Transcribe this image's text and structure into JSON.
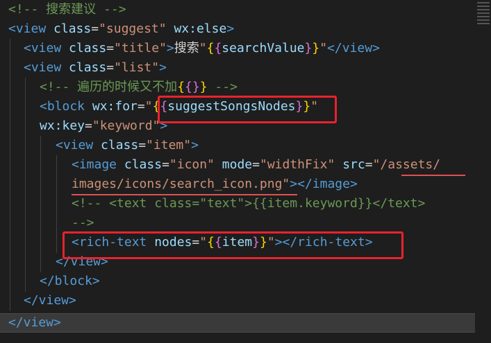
{
  "colors": {
    "background": "#1e1e1e",
    "comment": "#6a9955",
    "tag": "#569cd6",
    "attribute": "#9cdcfe",
    "string": "#ce9178",
    "text": "#d4d4d4",
    "bracket_gold": "#ffd700",
    "highlight_box": "#e8232f"
  },
  "code": [
    [
      [
        "cm",
        "<!-- 搜索建议 -->"
      ]
    ],
    [
      [
        "tag",
        "<view"
      ],
      [
        "txt",
        " "
      ],
      [
        "attr",
        "class"
      ],
      [
        "eq",
        "="
      ],
      [
        "str",
        "\"suggest\""
      ],
      [
        "txt",
        " "
      ],
      [
        "attr",
        "wx:else"
      ],
      [
        "tag",
        ">"
      ]
    ],
    [
      [
        "tag",
        "<view"
      ],
      [
        "txt",
        " "
      ],
      [
        "attr",
        "class"
      ],
      [
        "eq",
        "="
      ],
      [
        "str",
        "\"title\""
      ],
      [
        "tag",
        ">"
      ],
      [
        "txt",
        "搜索"
      ],
      [
        "str",
        "\""
      ],
      [
        "b1",
        "{"
      ],
      [
        "b2",
        "{"
      ],
      [
        "var",
        "searchValue"
      ],
      [
        "b2",
        "}"
      ],
      [
        "b1",
        "}"
      ],
      [
        "str",
        "\""
      ],
      [
        "tag",
        "</view>"
      ]
    ],
    [
      [
        "tag",
        "<view"
      ],
      [
        "txt",
        " "
      ],
      [
        "attr",
        "class"
      ],
      [
        "eq",
        "="
      ],
      [
        "str",
        "\"list\""
      ],
      [
        "tag",
        ">"
      ]
    ],
    [
      [
        "cm",
        "<!-- 遍历的时候又不加"
      ],
      [
        "b1",
        "{"
      ],
      [
        "b2",
        "{"
      ],
      [
        "b2",
        "}"
      ],
      [
        "b1",
        "}"
      ],
      [
        "cm",
        " -->"
      ]
    ],
    [
      [
        "tag",
        "<block"
      ],
      [
        "txt",
        " "
      ],
      [
        "attr",
        "wx:for"
      ],
      [
        "eq",
        "="
      ],
      [
        "str",
        "\""
      ],
      [
        "b1",
        "{"
      ],
      [
        "b2",
        "{"
      ],
      [
        "var",
        "suggestSongsNodes"
      ],
      [
        "b2",
        "}"
      ],
      [
        "b1",
        "}"
      ],
      [
        "str",
        "\""
      ]
    ],
    [
      [
        "attr",
        "wx:key"
      ],
      [
        "eq",
        "="
      ],
      [
        "str",
        "\"keyword\""
      ],
      [
        "tag",
        ">"
      ]
    ],
    [
      [
        "tag",
        "<view"
      ],
      [
        "txt",
        " "
      ],
      [
        "attr",
        "class"
      ],
      [
        "eq",
        "="
      ],
      [
        "str",
        "\"item\""
      ],
      [
        "tag",
        ">"
      ]
    ],
    [
      [
        "tag",
        "<image"
      ],
      [
        "txt",
        " "
      ],
      [
        "attr",
        "class"
      ],
      [
        "eq",
        "="
      ],
      [
        "str",
        "\"icon\""
      ],
      [
        "txt",
        " "
      ],
      [
        "attr",
        "mode"
      ],
      [
        "eq",
        "="
      ],
      [
        "str",
        "\"widthFix\""
      ],
      [
        "txt",
        " "
      ],
      [
        "attr",
        "src"
      ],
      [
        "eq",
        "="
      ],
      [
        "str",
        "\"/assets/"
      ]
    ],
    [
      [
        "str",
        "images/icons/search_icon.png\""
      ],
      [
        "tag",
        "></image>"
      ]
    ],
    [
      [
        "cm",
        "<!-- <text class=\"text\">{{item.keyword}}</text>"
      ]
    ],
    [
      [
        "cm",
        "-->"
      ]
    ],
    [
      [
        "tag",
        "<rich-text"
      ],
      [
        "txt",
        " "
      ],
      [
        "attr",
        "nodes"
      ],
      [
        "eq",
        "="
      ],
      [
        "str",
        "\""
      ],
      [
        "b1",
        "{"
      ],
      [
        "b2",
        "{"
      ],
      [
        "var",
        "item"
      ],
      [
        "b2",
        "}"
      ],
      [
        "b1",
        "}"
      ],
      [
        "str",
        "\""
      ],
      [
        "tag",
        "></rich-text>"
      ]
    ],
    [
      [
        "tag",
        "</view>"
      ]
    ],
    [
      [
        "tag",
        "</block>"
      ]
    ],
    [
      [
        "tag",
        "</view>"
      ]
    ],
    [
      [
        "tag",
        "</view>"
      ]
    ]
  ]
}
